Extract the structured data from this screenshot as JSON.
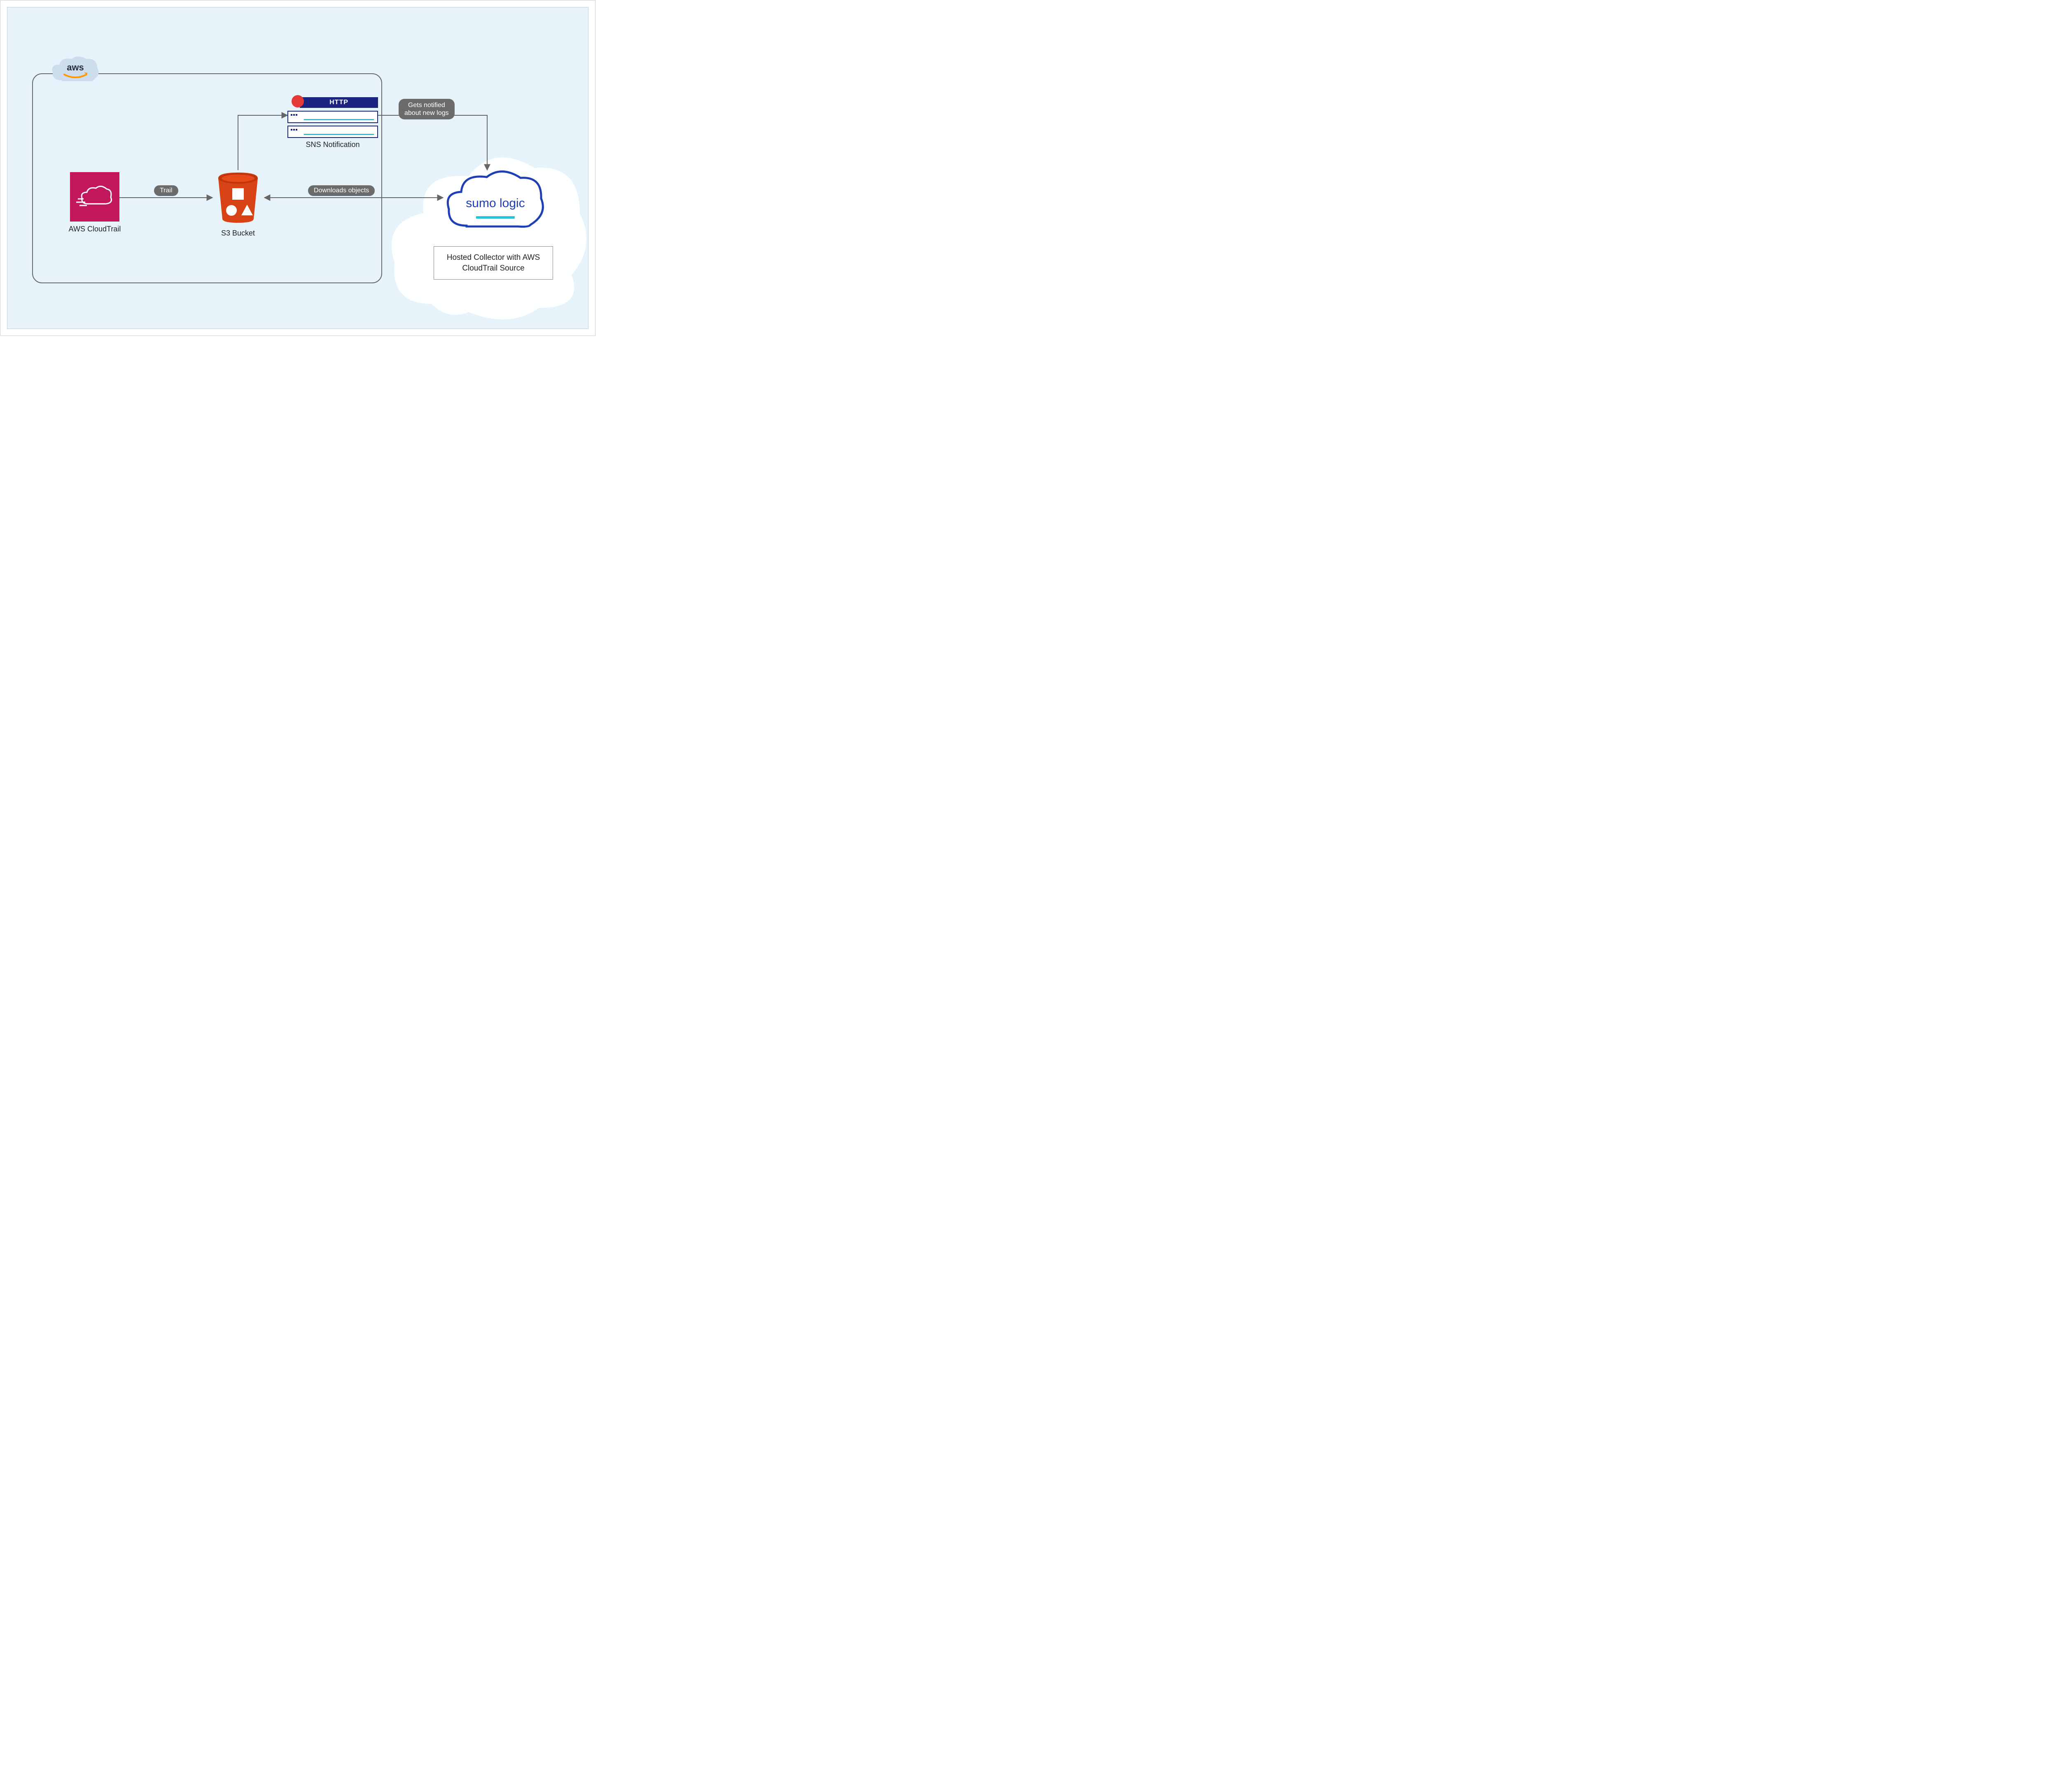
{
  "aws_label": "aws",
  "nodes": {
    "cloudtrail": "AWS CloudTrail",
    "s3": "S3 Bucket",
    "sns": "SNS Notification",
    "sns_http": "HTTP",
    "sumo": "sumo logic",
    "collector": "Hosted Collector with AWS CloudTrail Source"
  },
  "edges": {
    "trail": "Trail",
    "downloads": "Downloads objects",
    "notified_l1": "Gets notified",
    "notified_l2": "about new logs"
  },
  "colors": {
    "bg": "#e6f3fa",
    "cloudtrail": "#c2185b",
    "s3": "#d84315",
    "navy": "#1a237e",
    "cyan": "#26c6da",
    "pill": "#6b6b6b",
    "orange": "#ff9900",
    "sumo_blue": "#1e3fb5"
  }
}
